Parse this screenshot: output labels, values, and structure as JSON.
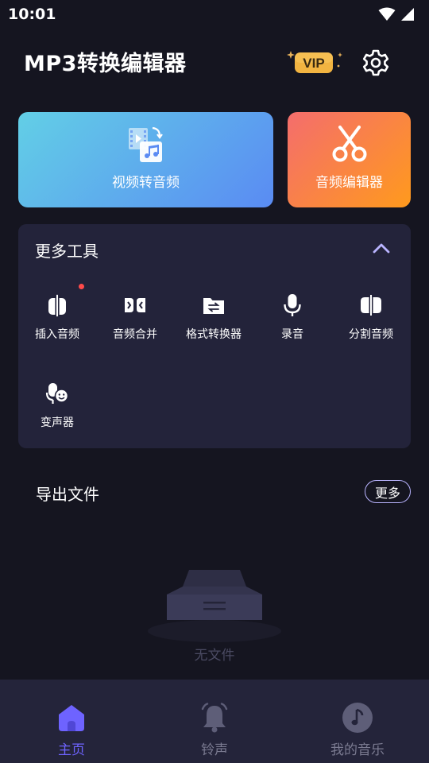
{
  "status_bar": {
    "time": "10:01"
  },
  "header": {
    "title": "MP3转换编辑器",
    "vip_label": "VIP"
  },
  "cards": {
    "video_to_audio": "视频转音频",
    "audio_editor": "音频编辑器"
  },
  "tools": {
    "title": "更多工具",
    "items": [
      {
        "label": "插入音频",
        "icon": "insert-audio-icon",
        "has_badge": true
      },
      {
        "label": "音频合并",
        "icon": "merge-audio-icon"
      },
      {
        "label": "格式转换器",
        "icon": "format-convert-icon"
      },
      {
        "label": "录音",
        "icon": "microphone-icon"
      },
      {
        "label": "分割音频",
        "icon": "split-audio-icon"
      },
      {
        "label": "变声器",
        "icon": "voice-changer-icon"
      }
    ]
  },
  "export": {
    "title": "导出文件",
    "more_label": "更多",
    "empty_text": "无文件"
  },
  "nav": {
    "items": [
      {
        "label": "主页",
        "icon": "home-icon",
        "active": true
      },
      {
        "label": "铃声",
        "icon": "bell-icon"
      },
      {
        "label": "我的音乐",
        "icon": "music-note-icon"
      }
    ]
  },
  "colors": {
    "background": "#151520",
    "panel": "#23233a",
    "accent": "#6e63ff",
    "nav_inactive": "#7a7a90"
  }
}
